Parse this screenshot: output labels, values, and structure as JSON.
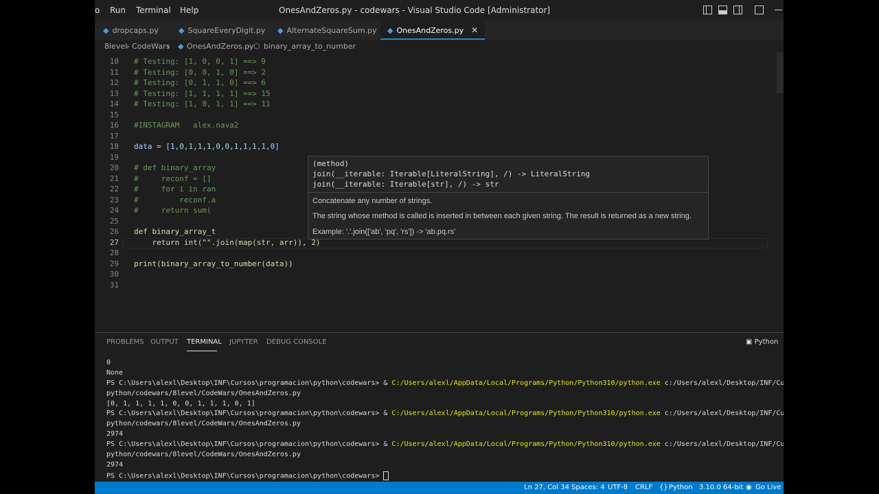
{
  "menu": [
    "o",
    "Run",
    "Terminal",
    "Help"
  ],
  "window_title": "OnesAndZeros.py - codewars - Visual Studio Code [Administrator]",
  "tabs": [
    {
      "label": "dropcaps.py",
      "active": false
    },
    {
      "label": "SquareEveryDigit.py",
      "active": false
    },
    {
      "label": "AlternateSquareSum.py",
      "active": false
    },
    {
      "label": "OnesAndZeros.py",
      "active": true
    }
  ],
  "tab_close": "✕",
  "breadcrumb": [
    "8level",
    "CodeWars",
    "OnesAndZeros.py",
    "binary_array_to_number"
  ],
  "editor": {
    "lines": [
      {
        "n": "10",
        "text": "# Testing: [1, 0, 0, 1] ==> 9"
      },
      {
        "n": "11",
        "text": "# Testing: [0, 0, 1, 0] ==> 2"
      },
      {
        "n": "12",
        "text": "# Testing: [0, 1, 1, 0] ==> 6"
      },
      {
        "n": "13",
        "text": "# Testing: [1, 1, 1, 1] ==> 15"
      },
      {
        "n": "14",
        "text": "# Testing: [1, 0, 1, 1] ==> 11"
      },
      {
        "n": "15",
        "text": ""
      },
      {
        "n": "16",
        "text": "#INSTAGRAM   alex.nava2"
      },
      {
        "n": "17",
        "text": ""
      },
      {
        "n": "18",
        "text": "data = [1,0,1,1,1,0,0,1,1,1,1,0]"
      },
      {
        "n": "19",
        "text": ""
      },
      {
        "n": "20",
        "text": "# def binary_array"
      },
      {
        "n": "21",
        "text": "#     reconf = []"
      },
      {
        "n": "22",
        "text": "#     for i in ran"
      },
      {
        "n": "23",
        "text": "#         reconf.a"
      },
      {
        "n": "24",
        "text": "#     return sum("
      },
      {
        "n": "25",
        "text": ""
      },
      {
        "n": "26",
        "text": "def binary_array_t"
      },
      {
        "n": "27",
        "text": "    return int(\"\".join(map(str, arr)), 2)"
      },
      {
        "n": "28",
        "text": ""
      },
      {
        "n": "29",
        "text": "print(binary_array_to_number(data))"
      },
      {
        "n": "30",
        "text": ""
      },
      {
        "n": "31",
        "text": ""
      }
    ]
  },
  "hover": {
    "kind": "(method)",
    "sig1": "join(__iterable: Iterable[LiteralString], /) -> LiteralString",
    "sig2": "join(__iterable: Iterable[str], /) -> str",
    "doc1": "Concatenate any number of strings.",
    "doc2": "The string whose method is called is inserted in between each given string. The result is returned as a new string.",
    "doc3": "Example: '.'.join(['ab', 'pq', 'rs']) -> 'ab.pq.rs'"
  },
  "panel": {
    "tabs": [
      "PROBLEMS",
      "OUTPUT",
      "TERMINAL",
      "JUPYTER",
      "DEBUG CONSOLE"
    ],
    "active_tab": "TERMINAL",
    "terminal_name": "Python",
    "lines": [
      {
        "t": "0"
      },
      {
        "t": "None"
      },
      {
        "t": "PS C:\\Users\\alexl\\Desktop\\INF\\Cursos\\programacion\\python\\codewars> & ",
        "y": "C:/Users/alexl/AppData/Local/Programs/Python/Python310/python.exe",
        "r": " c:/Users/alexl/Desktop/INF/Curs"
      },
      {
        "t": "python/codewars/8level/CodeWars/OnesAndZeros.py"
      },
      {
        "t": "[0, 1, 1, 1, 1, 0, 0, 1, 1, 1, 0, 1]"
      },
      {
        "t": "PS C:\\Users\\alexl\\Desktop\\INF\\Cursos\\programacion\\python\\codewars> & ",
        "y": "C:/Users/alexl/AppData/Local/Programs/Python/Python310/python.exe",
        "r": " c:/Users/alexl/Desktop/INF/Curs"
      },
      {
        "t": "python/codewars/8level/CodeWars/OnesAndZeros.py"
      },
      {
        "t": "2974"
      },
      {
        "t": "PS C:\\Users\\alexl\\Desktop\\INF\\Cursos\\programacion\\python\\codewars> & ",
        "y": "C:/Users/alexl/AppData/Local/Programs/Python/Python310/python.exe",
        "r": " c:/Users/alexl/Desktop/INF/Curs"
      },
      {
        "t": "python/codewars/8level/CodeWars/OnesAndZeros.py"
      },
      {
        "t": "2974"
      },
      {
        "t": "PS C:\\Users\\alexl\\Desktop\\INF\\Cursos\\programacion\\python\\codewars> ",
        "cursor": true
      }
    ]
  },
  "status": {
    "position": "Ln 27, Col 34",
    "spaces": "Spaces: 4",
    "encoding": "UTF-8",
    "eol": "CRLF",
    "language": "Python",
    "interpreter": "3.10.0 64-bit",
    "golive": "Go Live"
  },
  "colors": {
    "accent": "#007acc",
    "editor_bg": "#1e1e1e",
    "terminal_path": "#e5e510"
  }
}
